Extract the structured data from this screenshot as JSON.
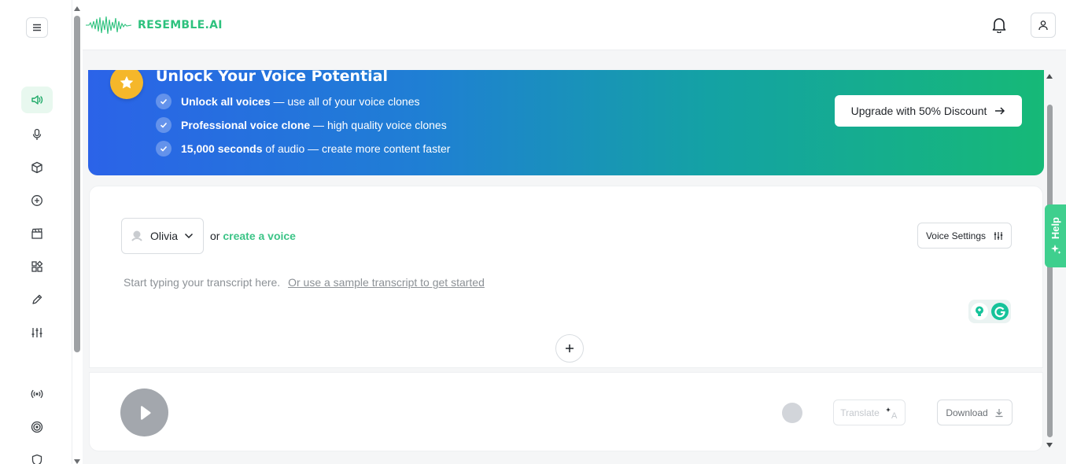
{
  "brand": {
    "name": "RESEMBLE.AI",
    "color": "#2ec27e"
  },
  "sidebar": {
    "items": [
      {
        "icon": "speaker-icon",
        "active": true
      },
      {
        "icon": "microphone-icon"
      },
      {
        "icon": "cube-icon"
      },
      {
        "icon": "plus-circle-icon"
      },
      {
        "icon": "clapperboard-icon"
      },
      {
        "icon": "apps-grid-icon"
      },
      {
        "icon": "pencil-icon"
      },
      {
        "icon": "sliders-icon"
      },
      {
        "icon": "broadcast-icon"
      },
      {
        "icon": "target-icon"
      },
      {
        "icon": "shield-icon"
      }
    ]
  },
  "banner": {
    "title": "Unlock Your Voice Potential",
    "features": [
      {
        "bold": "Unlock all voices",
        "rest": " — use all of your voice clones"
      },
      {
        "bold": "Professional voice clone",
        "rest": " — high quality voice clones"
      },
      {
        "bold": "15,000 seconds",
        "rest": " of audio — create more content faster"
      }
    ],
    "cta": "Upgrade with 50% Discount"
  },
  "editor": {
    "voice": "Olivia",
    "or_text": "or",
    "create_voice": "create a voice",
    "voice_settings": "Voice Settings",
    "placeholder": "Start typing your transcript here.",
    "sample_link": "Or use a sample transcript to get started"
  },
  "player": {
    "translate": "Translate",
    "download": "Download"
  },
  "help": {
    "label": "Help"
  }
}
